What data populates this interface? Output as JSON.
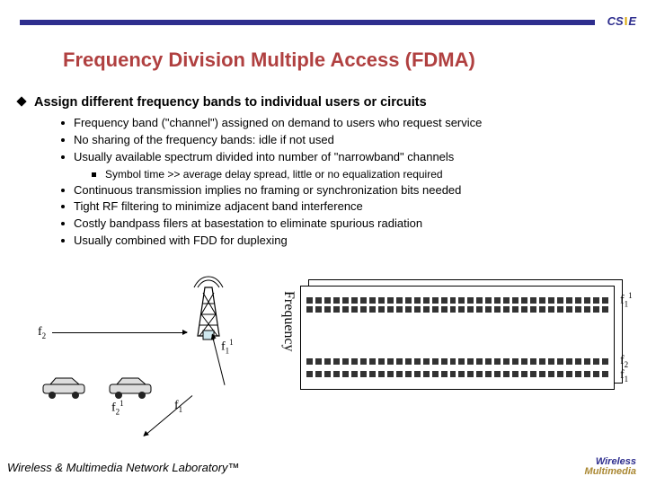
{
  "title": "Frequency Division Multiple Access (FDMA)",
  "logo_top": {
    "c": "C",
    "s": "S",
    "e": "I",
    "suffix": "E"
  },
  "heading": "Assign different frequency bands to individual users or circuits",
  "bullets": [
    "Frequency band (\"channel\") assigned on demand to users who request service",
    "No sharing of the frequency bands: idle if not used",
    "Usually available spectrum divided into number of \"narrowband\" channels"
  ],
  "sub_bullet": "Symbol time >> average delay spread, little or no equalization required",
  "bullets2": [
    "Continuous transmission implies no framing or synchronization bits needed",
    "Tight RF filtering to minimize adjacent band interference",
    "Costly bandpass filers at basestation to eliminate spurious radiation",
    "Usually combined with FDD for duplexing"
  ],
  "diagram": {
    "f2": "f",
    "f21": "f",
    "f1": "f",
    "f11": "f",
    "freq_axis": "Frequency",
    "right_f11": "f",
    "right_f2": "f",
    "right_f1": "f"
  },
  "footer": "Wireless & Multimedia Network Laboratory™",
  "logo_bot": {
    "l1": "Wireless",
    "l2": "Multimedia"
  }
}
